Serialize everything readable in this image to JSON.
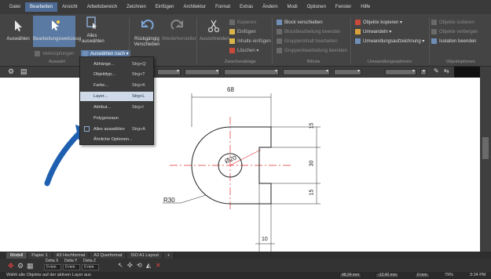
{
  "menubar": [
    "Datei",
    "Bearbeiten",
    "Ansicht",
    "Arbeitsbereich",
    "Zeichnen",
    "Einfügen",
    "Architektur",
    "Format",
    "Extras",
    "Ändern",
    "Modi",
    "Optionen",
    "Fenster",
    "Hilfe"
  ],
  "ribbon": {
    "auswaehlen": "Auswählen",
    "bearbeitungswerkzeug": "Bearbeitungswerkzeug",
    "alles_auswaehlen_1": "Alles",
    "alles_auswaehlen_2": "auswählen",
    "auswaehlen_nach": "Auswählen nach ▾",
    "verknuepfungen": "Verknüpfungen",
    "auswahl_label": "Auswahl",
    "rueckgaengig": "Rückgängig",
    "wiederherstellen": "Wiederherstellen",
    "verschieben": "Verschieben",
    "ausschneiden": "Ausschneiden",
    "kopieren": "Kopieren",
    "einfuegen": "Einfügen",
    "inhalte_einfuegen": "Inhalte einfügen",
    "loeschen": "Löschen ▾",
    "zwischenablage_label": "Zwischenablage",
    "block_verschieben": "Block verschieben",
    "blockbearbeitung_beenden": "Blockbearbeitung beenden",
    "gruppeninhalt_bearbeiten": "Gruppeninhalt bearbeiten",
    "gruppenbearbeitung_beenden": "Gruppenbearbeitung beenden",
    "bloecke_label": "Blöcke",
    "objekte_kopieren": "Objekte kopieren ▾",
    "umwandeln": "Umwandeln ▾",
    "umwandlungsaufzeichnung": "Umwandlungsaufzeichnung ▾",
    "umwandlungsoptionen_label": "Umwandlungsoptionen",
    "objekte_isolieren": "Objekte isolieren",
    "objekte_verbergen": "Objekte verbergen",
    "isolation_beenden": "Isolation beenden",
    "objektoptionen_label": "Objektoptionen"
  },
  "dropdown": [
    {
      "label": "Abhänge...",
      "shortcut": "Strg+Q"
    },
    {
      "label": "Objekttyp...",
      "shortcut": "Strg+T"
    },
    {
      "label": "Farbe...",
      "shortcut": "Strg+K"
    },
    {
      "label": "Layer...",
      "shortcut": "Strg+L",
      "highlighted": true
    },
    {
      "label": "Attribut...",
      "shortcut": "Strg+I"
    },
    {
      "label": "Polygonzaun",
      "shortcut": ""
    },
    {
      "label": "Alles auswählen",
      "shortcut": "Strg+A"
    },
    {
      "label": "Ähnliche Optionen...",
      "shortcut": ""
    }
  ],
  "drawing": {
    "dim_68": "68",
    "dim_15a": "15",
    "dim_30": "30",
    "dim_15b": "15",
    "dim_10": "10",
    "dim_d20": "Ø20",
    "dim_r30": "R30"
  },
  "tabs": [
    "Modell",
    "Papier 1",
    "A3 Hochformat",
    "A3 Querformat",
    "ISO A1 Layout"
  ],
  "cmd": {
    "delta_x_label": "Delta X",
    "delta_y_label": "Delta Y",
    "delta_z_label": "Delta Z",
    "delta_x": "0 mm",
    "delta_y": "0 mm",
    "delta_z": "0 mm"
  },
  "status": {
    "text": "Wählt alle Objekte auf der aktiven Layer aus",
    "coord_x": "48,24 mm",
    "coord_y": "-12,42 mm",
    "coord_z": "0 mm",
    "zoom": "79%",
    "time": "3:34 PM"
  },
  "colors": {
    "ui_dark": "#3a3a3a",
    "accent": "#4d6b94",
    "centerline": "#e03030",
    "arrow": "#1e5fb0"
  }
}
